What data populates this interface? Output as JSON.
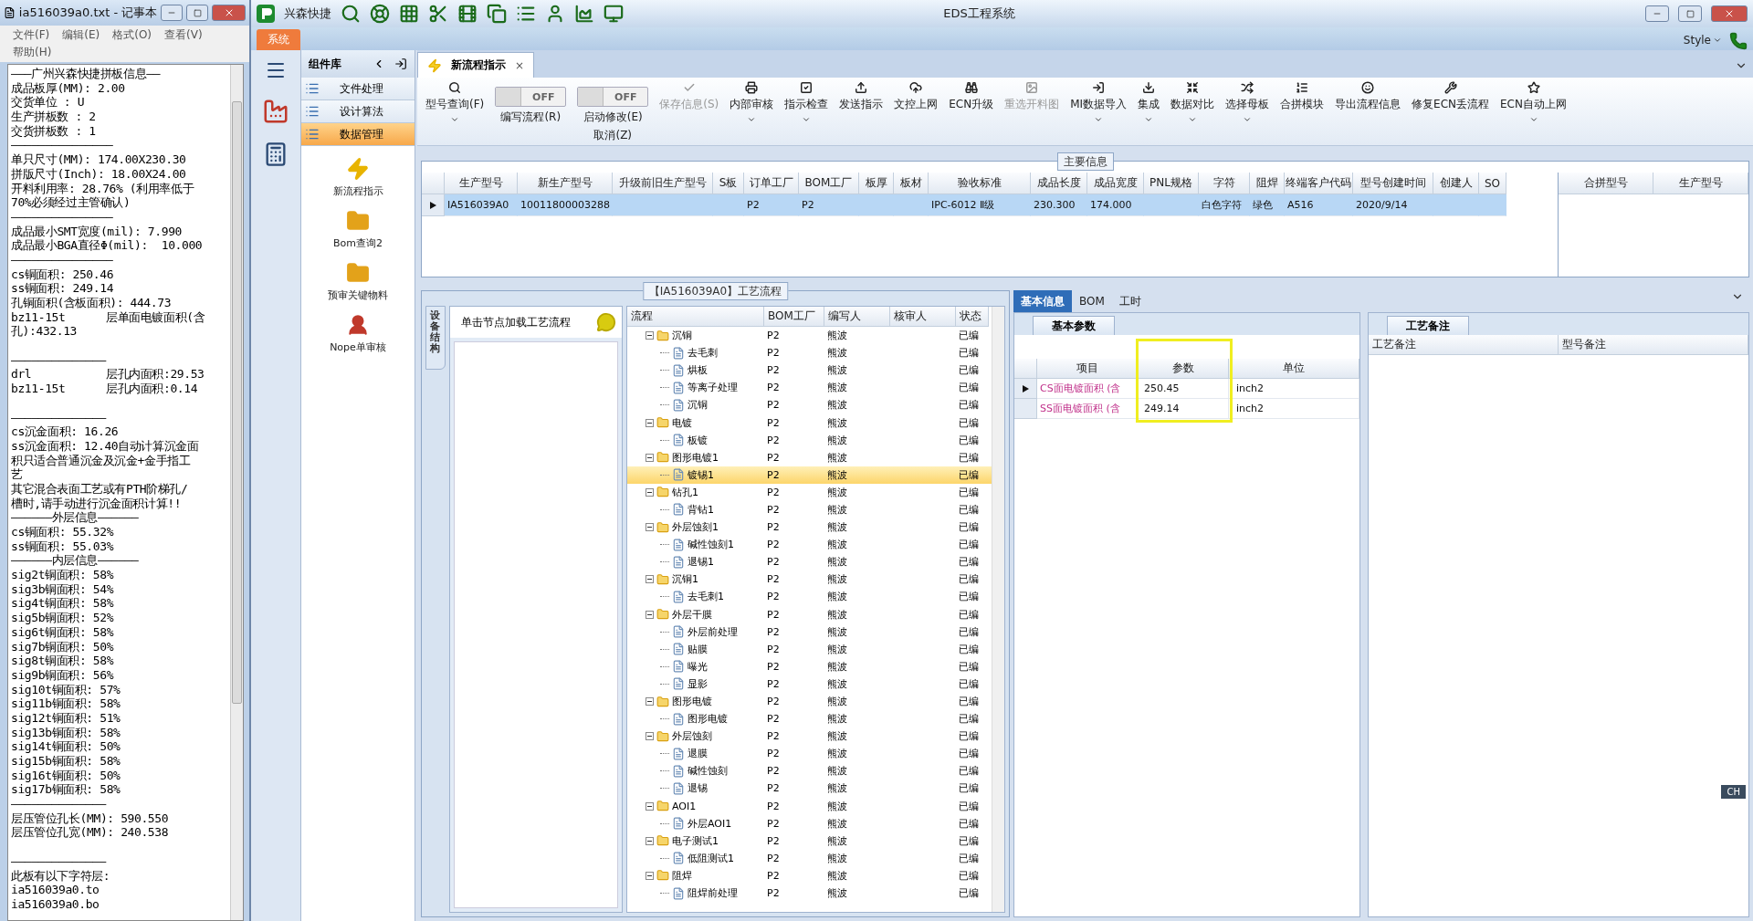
{
  "notepad": {
    "title": "ia516039a0.txt - 记事本",
    "menu": [
      "文件(F)",
      "编辑(E)",
      "格式(O)",
      "查看(V)",
      "帮助(H)"
    ],
    "lines": [
      {
        "kind": "text",
        "text": "———广州兴森快捷拼板信息——"
      },
      {
        "kind": "text",
        "text": "成品板厚(MM): 2.00"
      },
      {
        "kind": "text",
        "text": "交货单位 : U"
      },
      {
        "kind": "text",
        "text": "生产拼板数 : 2"
      },
      {
        "kind": "text",
        "text": "交货拼板数 : 1"
      },
      {
        "kind": "text",
        "text": "———————————————"
      },
      {
        "kind": "text",
        "text": "单只尺寸(MM): 174.00X230.30"
      },
      {
        "kind": "text",
        "text": "拼版尺寸(Inch): 18.00X24.00"
      },
      {
        "kind": "text",
        "text": "开料利用率: 28.76% (利用率低于"
      },
      {
        "kind": "text",
        "text": "70%必须经过主管确认)"
      },
      {
        "kind": "text",
        "text": "———————————————"
      },
      {
        "kind": "text",
        "text": "成品最小SMT宽度(mil): 7.990"
      },
      {
        "kind": "text",
        "text": "成品最小BGA直径Φ(mil):  10.000"
      },
      {
        "kind": "text",
        "text": "———————————————"
      },
      {
        "kind": "text",
        "text": "cs铜面积: 250.46"
      },
      {
        "kind": "text",
        "text": "ss铜面积: 249.14"
      },
      {
        "kind": "text",
        "text": "孔铜面积(含板面积): 444.73"
      },
      {
        "kind": "text",
        "text": "bz11-15t      层单面电镀面积(含"
      },
      {
        "kind": "text",
        "text": "孔):432.13"
      },
      {
        "kind": "blank"
      },
      {
        "kind": "text",
        "text": "——————————————"
      },
      {
        "kind": "text",
        "text": "drl           层孔内面积:29.53"
      },
      {
        "kind": "text",
        "text": "bz11-15t      层孔内面积:0.14"
      },
      {
        "kind": "blank"
      },
      {
        "kind": "text",
        "text": "——————————————"
      },
      {
        "kind": "text",
        "text": "cs沉金面积: 16.26"
      },
      {
        "kind": "text",
        "text": "ss沉金面积: 12.40自动计算沉金面"
      },
      {
        "kind": "text",
        "text": "积只适合普通沉金及沉金+金手指工"
      },
      {
        "kind": "text",
        "text": "艺"
      },
      {
        "kind": "text",
        "text": "其它混合表面工艺或有PTH阶梯孔/"
      },
      {
        "kind": "text",
        "text": "槽时,请手动进行沉金面积计算!!"
      },
      {
        "kind": "text",
        "text": "——————外层信息——————"
      },
      {
        "kind": "text",
        "text": "cs铜面积: 55.32%"
      },
      {
        "kind": "text",
        "text": "ss铜面积: 55.03%"
      },
      {
        "kind": "text",
        "text": "——————内层信息——————"
      },
      {
        "kind": "text",
        "text": "sig2t铜面积: 58%"
      },
      {
        "kind": "text",
        "text": "sig3b铜面积: 54%"
      },
      {
        "kind": "text",
        "text": "sig4t铜面积: 58%"
      },
      {
        "kind": "text",
        "text": "sig5b铜面积: 52%"
      },
      {
        "kind": "text",
        "text": "sig6t铜面积: 58%"
      },
      {
        "kind": "text",
        "text": "sig7b铜面积: 50%"
      },
      {
        "kind": "text",
        "text": "sig8t铜面积: 58%"
      },
      {
        "kind": "text",
        "text": "sig9b铜面积: 56%"
      },
      {
        "kind": "text",
        "text": "sig10t铜面积: 57%"
      },
      {
        "kind": "text",
        "text": "sig11b铜面积: 58%"
      },
      {
        "kind": "text",
        "text": "sig12t铜面积: 51%"
      },
      {
        "kind": "text",
        "text": "sig13b铜面积: 58%"
      },
      {
        "kind": "text",
        "text": "sig14t铜面积: 50%"
      },
      {
        "kind": "text",
        "text": "sig15b铜面积: 58%"
      },
      {
        "kind": "text",
        "text": "sig16t铜面积: 50%"
      },
      {
        "kind": "text",
        "text": "sig17b铜面积: 58%"
      },
      {
        "kind": "text",
        "text": "——————————————"
      },
      {
        "kind": "text",
        "text": "层压管位孔长(MM): 590.550"
      },
      {
        "kind": "text",
        "text": "层压管位孔宽(MM): 240.538"
      },
      {
        "kind": "blank"
      },
      {
        "kind": "text",
        "text": "——————————————"
      },
      {
        "kind": "text",
        "text": "此板有以下字符层:"
      },
      {
        "kind": "text",
        "text": "ia516039a0.to"
      },
      {
        "kind": "text",
        "text": "ia516039a0.bo"
      }
    ]
  },
  "app": {
    "brand": "兴森快捷",
    "title": "EDS工程系统",
    "style_menu": "Style",
    "menu_tab": "系统"
  },
  "component_panel": {
    "title": "组件库",
    "items": [
      {
        "label": "文件处理",
        "selected": false
      },
      {
        "label": "设计算法",
        "selected": false
      },
      {
        "label": "数据管理",
        "selected": true
      }
    ],
    "tools": [
      "新流程指示",
      "Bom查询2",
      "预审关键物料",
      "Nope单审核"
    ]
  },
  "doc_tab": {
    "label": "新流程指示",
    "close": "×"
  },
  "toolbar": [
    {
      "kind": "button",
      "label": "型号查询(F)",
      "disabled": false,
      "dropdown": true
    },
    {
      "kind": "toggle",
      "label": "编写流程(R)",
      "state": "OFF",
      "on": false
    },
    {
      "kind": "toggle",
      "label": "启动修改(E)",
      "label2": "取消(Z)",
      "state": "OFF",
      "on": false
    },
    {
      "kind": "button",
      "label": "保存信息(S)",
      "disabled": true,
      "dropdown": false
    },
    {
      "kind": "button",
      "label": "内部审核",
      "disabled": false,
      "dropdown": true
    },
    {
      "kind": "button",
      "label": "指示检查",
      "disabled": false,
      "dropdown": true
    },
    {
      "kind": "button",
      "label": "发送指示",
      "disabled": false,
      "dropdown": false
    },
    {
      "kind": "button",
      "label": "文控上网",
      "disabled": false,
      "dropdown": false
    },
    {
      "kind": "button",
      "label": "ECN升级",
      "disabled": false,
      "dropdown": false
    },
    {
      "kind": "button",
      "label": "重选开料图",
      "disabled": true,
      "dropdown": false
    },
    {
      "kind": "button",
      "label": "MI数据导入",
      "disabled": false,
      "dropdown": true
    },
    {
      "kind": "button",
      "label": "集成",
      "disabled": false,
      "dropdown": true
    },
    {
      "kind": "button",
      "label": "数据对比",
      "disabled": false,
      "dropdown": true
    },
    {
      "kind": "button",
      "label": "选择母板",
      "disabled": false,
      "dropdown": true
    },
    {
      "kind": "button",
      "label": "合拼模块",
      "disabled": false,
      "dropdown": false
    },
    {
      "kind": "button",
      "label": "导出流程信息",
      "disabled": false,
      "dropdown": false
    },
    {
      "kind": "button",
      "label": "修复ECN丢流程",
      "disabled": false,
      "dropdown": false
    },
    {
      "kind": "button",
      "label": "ECN自动上网",
      "disabled": false,
      "dropdown": true
    }
  ],
  "main_info": {
    "title": "主要信息",
    "columns": [
      "生产型号",
      "新生产型号",
      "升级前旧生产型号",
      "S板",
      "订单工厂",
      "BOM工厂",
      "板厚",
      "板材",
      "验收标准",
      "成品长度",
      "成品宽度",
      "PNL规格",
      "字符",
      "阻焊",
      "终端客户代码",
      "型号创建时间",
      "创建人",
      "SO"
    ],
    "rows": [
      {
        "selected": true,
        "cells": [
          "IA516039A0",
          "10011800003288",
          "",
          "",
          "P2",
          "P2",
          "",
          "",
          "IPC-6012 Ⅱ级",
          "230.300",
          "174.000",
          "",
          "白色字符",
          "绿色",
          "A516",
          "2020/9/14",
          "",
          ""
        ]
      }
    ],
    "merge_columns": [
      "合拼型号",
      "生产型号"
    ]
  },
  "process": {
    "title": "【IA516039A0】工艺流程",
    "side_tab": "设备结构",
    "hint": "单击节点加载工艺流程",
    "columns": [
      "流程",
      "BOM工厂",
      "编写人",
      "核审人",
      "状态"
    ],
    "tree": [
      {
        "name": "沉铜",
        "factory": "P2",
        "writer": "熊波",
        "status": "已编",
        "expanded": true,
        "selected": false,
        "children": [
          {
            "name": "去毛刺",
            "factory": "P2",
            "writer": "熊波",
            "status": "已编",
            "selected": false
          },
          {
            "name": "烘板",
            "factory": "P2",
            "writer": "熊波",
            "status": "已编",
            "selected": false
          },
          {
            "name": "等离子处理",
            "factory": "P2",
            "writer": "熊波",
            "status": "已编",
            "selected": false
          },
          {
            "name": "沉铜",
            "factory": "P2",
            "writer": "熊波",
            "status": "已编",
            "selected": false
          }
        ]
      },
      {
        "name": "电镀",
        "factory": "P2",
        "writer": "熊波",
        "status": "已编",
        "expanded": true,
        "selected": false,
        "children": [
          {
            "name": "板镀",
            "factory": "P2",
            "writer": "熊波",
            "status": "已编",
            "selected": false
          }
        ]
      },
      {
        "name": "图形电镀1",
        "factory": "P2",
        "writer": "熊波",
        "status": "已编",
        "expanded": true,
        "selected": false,
        "children": [
          {
            "name": "镀锡1",
            "factory": "P2",
            "writer": "熊波",
            "status": "已编",
            "selected": true
          }
        ]
      },
      {
        "name": "钻孔1",
        "factory": "P2",
        "writer": "熊波",
        "status": "已编",
        "expanded": true,
        "selected": false,
        "children": [
          {
            "name": "背钻1",
            "factory": "P2",
            "writer": "熊波",
            "status": "已编",
            "selected": false
          }
        ]
      },
      {
        "name": "外层蚀刻1",
        "factory": "P2",
        "writer": "熊波",
        "status": "已编",
        "expanded": true,
        "selected": false,
        "children": [
          {
            "name": "碱性蚀刻1",
            "factory": "P2",
            "writer": "熊波",
            "status": "已编",
            "selected": false
          },
          {
            "name": "退锡1",
            "factory": "P2",
            "writer": "熊波",
            "status": "已编",
            "selected": false
          }
        ]
      },
      {
        "name": "沉铜1",
        "factory": "P2",
        "writer": "熊波",
        "status": "已编",
        "expanded": true,
        "selected": false,
        "children": [
          {
            "name": "去毛刺1",
            "factory": "P2",
            "writer": "熊波",
            "status": "已编",
            "selected": false
          }
        ]
      },
      {
        "name": "外层干膜",
        "factory": "P2",
        "writer": "熊波",
        "status": "已编",
        "expanded": true,
        "selected": false,
        "children": [
          {
            "name": "外层前处理",
            "factory": "P2",
            "writer": "熊波",
            "status": "已编",
            "selected": false
          },
          {
            "name": "贴膜",
            "factory": "P2",
            "writer": "熊波",
            "status": "已编",
            "selected": false
          },
          {
            "name": "曝光",
            "factory": "P2",
            "writer": "熊波",
            "status": "已编",
            "selected": false
          },
          {
            "name": "显影",
            "factory": "P2",
            "writer": "熊波",
            "status": "已编",
            "selected": false
          }
        ]
      },
      {
        "name": "图形电镀",
        "factory": "P2",
        "writer": "熊波",
        "status": "已编",
        "expanded": true,
        "selected": false,
        "children": [
          {
            "name": "图形电镀",
            "factory": "P2",
            "writer": "熊波",
            "status": "已编",
            "selected": false
          }
        ]
      },
      {
        "name": "外层蚀刻",
        "factory": "P2",
        "writer": "熊波",
        "status": "已编",
        "expanded": true,
        "selected": false,
        "children": [
          {
            "name": "退膜",
            "factory": "P2",
            "writer": "熊波",
            "status": "已编",
            "selected": false
          },
          {
            "name": "碱性蚀刻",
            "factory": "P2",
            "writer": "熊波",
            "status": "已编",
            "selected": false
          },
          {
            "name": "退锡",
            "factory": "P2",
            "writer": "熊波",
            "status": "已编",
            "selected": false
          }
        ]
      },
      {
        "name": "AOI1",
        "factory": "P2",
        "writer": "熊波",
        "status": "已编",
        "expanded": true,
        "selected": false,
        "children": [
          {
            "name": "外层AOI1",
            "factory": "P2",
            "writer": "熊波",
            "status": "已编",
            "selected": false
          }
        ]
      },
      {
        "name": "电子测试1",
        "factory": "P2",
        "writer": "熊波",
        "status": "已编",
        "expanded": true,
        "selected": false,
        "children": [
          {
            "name": "低阻测试1",
            "factory": "P2",
            "writer": "熊波",
            "status": "已编",
            "selected": false
          }
        ]
      },
      {
        "name": "阻焊",
        "factory": "P2",
        "writer": "熊波",
        "status": "已编",
        "expanded": true,
        "selected": false,
        "children": [
          {
            "name": "阻焊前处理",
            "factory": "P2",
            "writer": "熊波",
            "status": "已编",
            "selected": false
          }
        ]
      }
    ]
  },
  "info_tabs": [
    {
      "label": "基本信息",
      "selected": true
    },
    {
      "label": "BOM",
      "selected": false
    },
    {
      "label": "工时",
      "selected": false
    }
  ],
  "basic_params": {
    "tab": "基本参数",
    "columns": [
      "项目",
      "参数",
      "单位"
    ],
    "rows": [
      {
        "item": "CS面电镀面积 (含",
        "value": "250.45",
        "unit": "inch2"
      },
      {
        "item": "SS面电镀面积 (含",
        "value": "249.14",
        "unit": "inch2"
      }
    ]
  },
  "notes": {
    "tab": "工艺备注",
    "columns": [
      "工艺备注",
      "型号备注"
    ]
  },
  "ime": {
    "label": "CH"
  }
}
